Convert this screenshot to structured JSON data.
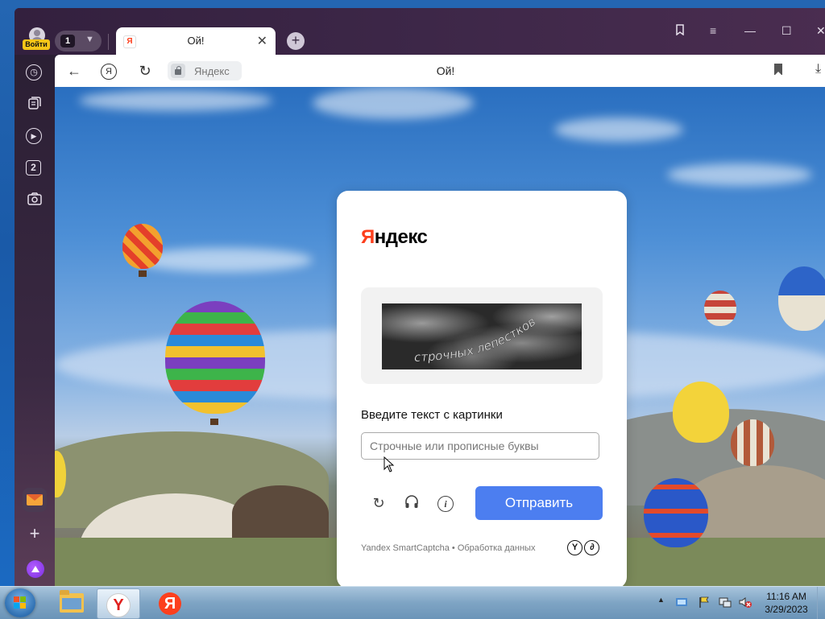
{
  "browser": {
    "profile": {
      "login_label": "Войти"
    },
    "tabs_count": "1",
    "active_tab": {
      "title": "Ой!",
      "favicon": "Я"
    },
    "window_controls": [
      "bookmarks-panel-icon",
      "menu-icon",
      "minimize-icon",
      "maximize-icon",
      "close-icon"
    ]
  },
  "toolbar": {
    "address_host": "Яндекс",
    "page_title": "Ой!"
  },
  "sidebar": {
    "items": [
      {
        "icon": "history-icon"
      },
      {
        "icon": "collections-icon"
      },
      {
        "icon": "video-icon"
      },
      {
        "icon": "counter-2-icon",
        "label": "2"
      },
      {
        "icon": "screenshot-icon"
      }
    ],
    "bottom": [
      "mail-icon",
      "add-icon",
      "alice-icon"
    ]
  },
  "captcha": {
    "logo": {
      "first": "Я",
      "rest": "ндекс"
    },
    "image_text": "строчных лепестков",
    "prompt": "Введите текст с картинки",
    "input_value": "",
    "input_placeholder": "Строчные или прописные буквы",
    "submit_label": "Отправить",
    "footer": "Yandex SmartCaptcha • Обработка данных",
    "footer_icons": [
      "Y",
      "∂"
    ],
    "accent_color": "#4c7ef0"
  },
  "taskbar": {
    "apps": [
      "explorer",
      "yandex-browser",
      "yandex"
    ],
    "clock_time": "11:16 AM",
    "clock_date": "3/29/2023"
  }
}
